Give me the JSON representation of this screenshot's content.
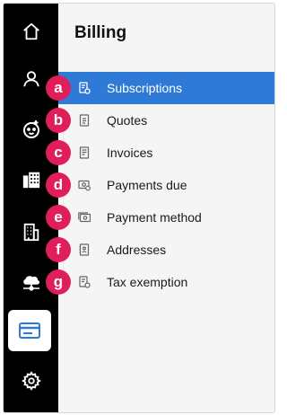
{
  "colors": {
    "rail_background": "#000000",
    "accent": "#2f7ad7",
    "badge": "#e01e5a",
    "panel_background": "#f5f5f5"
  },
  "rail": {
    "items": [
      {
        "icon": "home-icon"
      },
      {
        "icon": "user-icon"
      },
      {
        "icon": "baby-face-icon"
      },
      {
        "icon": "building-apartments-icon"
      },
      {
        "icon": "office-building-icon"
      },
      {
        "icon": "cloud-network-icon"
      },
      {
        "icon": "credit-card-icon",
        "active": true
      },
      {
        "icon": "gear-icon"
      }
    ]
  },
  "billing": {
    "title": "Billing",
    "items": [
      {
        "label": "Subscriptions",
        "icon": "subscription-doc-icon",
        "active": true
      },
      {
        "label": "Quotes",
        "icon": "quote-doc-icon"
      },
      {
        "label": "Invoices",
        "icon": "invoice-doc-icon"
      },
      {
        "label": "Payments due",
        "icon": "payment-due-icon"
      },
      {
        "label": "Payment method",
        "icon": "payment-method-icon"
      },
      {
        "label": "Addresses",
        "icon": "address-book-icon"
      },
      {
        "label": "Tax exemption",
        "icon": "tax-exemption-doc-icon"
      }
    ]
  },
  "badges": [
    "a",
    "b",
    "c",
    "d",
    "e",
    "f",
    "g"
  ]
}
